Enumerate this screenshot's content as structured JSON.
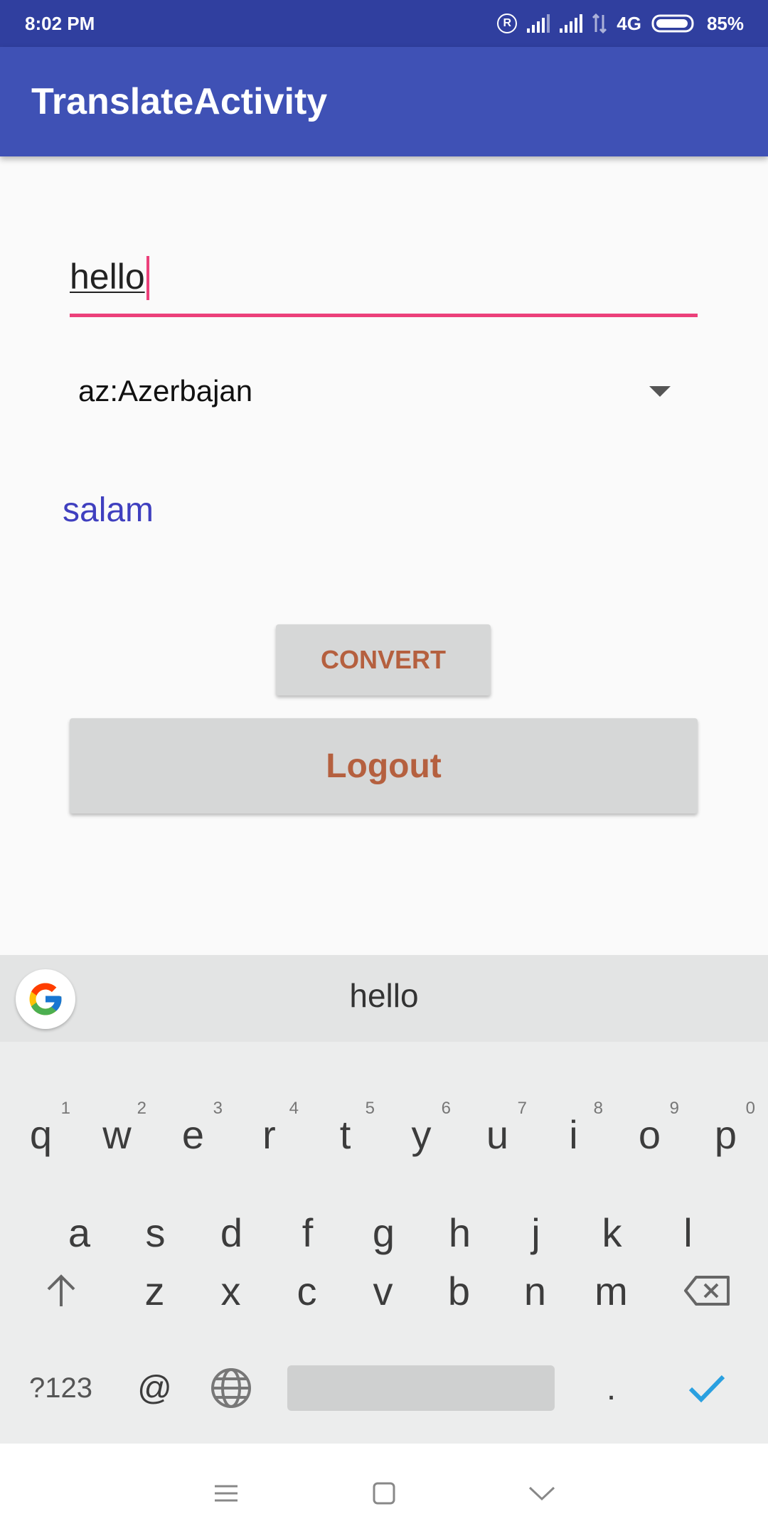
{
  "status_bar": {
    "time": "8:02 PM",
    "network": "4G",
    "battery": "85%"
  },
  "app_bar": {
    "title": "TranslateActivity"
  },
  "form": {
    "input_value": "hello",
    "language_selected": "az:Azerbajan",
    "result": "salam",
    "convert_label": "CONVERT",
    "logout_label": "Logout"
  },
  "keyboard": {
    "suggestion": "hello",
    "row1": [
      {
        "key": "q",
        "hint": "1"
      },
      {
        "key": "w",
        "hint": "2"
      },
      {
        "key": "e",
        "hint": "3"
      },
      {
        "key": "r",
        "hint": "4"
      },
      {
        "key": "t",
        "hint": "5"
      },
      {
        "key": "y",
        "hint": "6"
      },
      {
        "key": "u",
        "hint": "7"
      },
      {
        "key": "i",
        "hint": "8"
      },
      {
        "key": "o",
        "hint": "9"
      },
      {
        "key": "p",
        "hint": "0"
      }
    ],
    "row2": [
      "a",
      "s",
      "d",
      "f",
      "g",
      "h",
      "j",
      "k",
      "l"
    ],
    "row3": [
      "z",
      "x",
      "c",
      "v",
      "b",
      "n",
      "m"
    ],
    "symbols_label": "?123",
    "at_label": "@",
    "period_label": "."
  },
  "colors": {
    "status_bar": "#303f9f",
    "app_bar": "#3f51b5",
    "accent": "#ec407a",
    "result_text": "#3f3fbf",
    "button_text": "#b5603f"
  }
}
